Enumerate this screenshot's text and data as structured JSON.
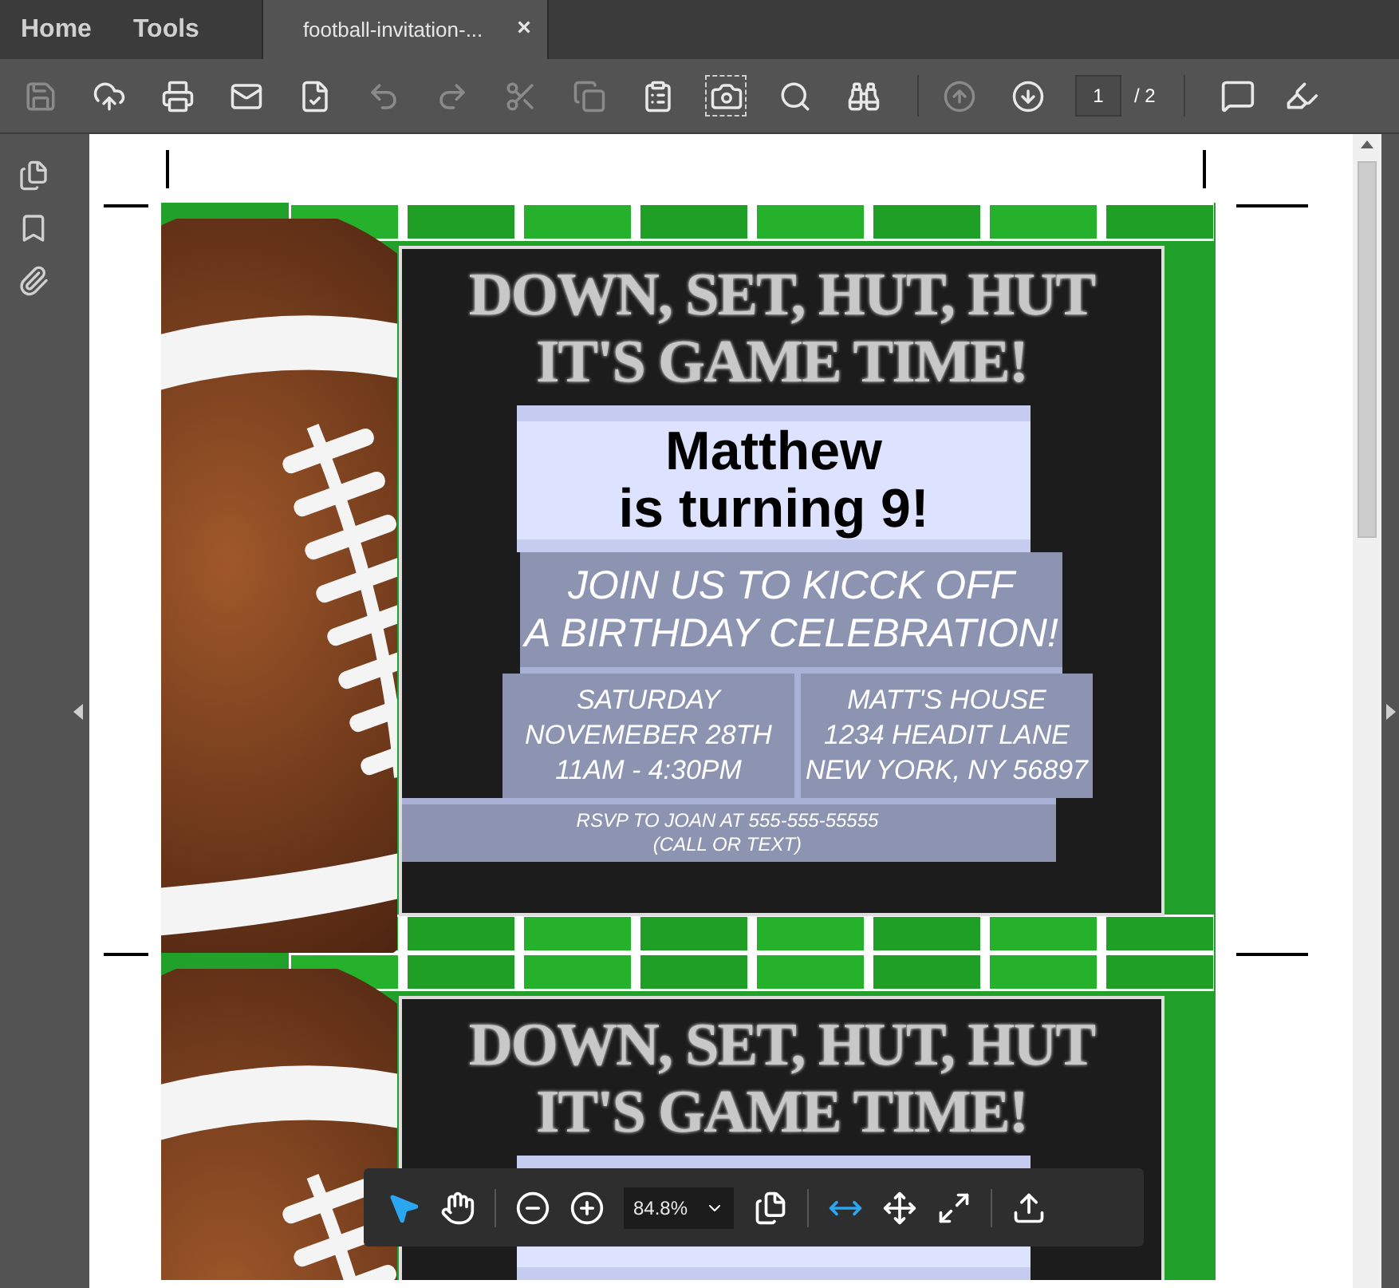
{
  "tabs": [
    {
      "label": "Home",
      "selected": false
    },
    {
      "label": "Tools",
      "selected": false
    }
  ],
  "document_tab": {
    "label": "football-invitation-...",
    "close": "×",
    "selected": true
  },
  "toolbar": [
    {
      "kind": "save",
      "disabled": true
    },
    {
      "kind": "upload",
      "disabled": false
    },
    {
      "kind": "print",
      "disabled": false
    },
    {
      "kind": "mail",
      "disabled": false
    },
    {
      "kind": "spell",
      "disabled": false
    },
    {
      "kind": "undo",
      "disabled": true
    },
    {
      "kind": "redo",
      "disabled": true
    },
    {
      "kind": "cut",
      "disabled": true
    },
    {
      "kind": "copy",
      "disabled": true
    },
    {
      "kind": "paste",
      "disabled": false
    },
    {
      "kind": "snapshot",
      "disabled": false
    },
    {
      "kind": "search",
      "disabled": false
    },
    {
      "kind": "find",
      "disabled": false
    },
    {
      "kind": "prev",
      "disabled": true
    },
    {
      "kind": "next",
      "disabled": false
    }
  ],
  "page_field": {
    "value": "1",
    "total": "/ 2"
  },
  "pages": [
    {
      "headline": [
        "DOWN, SET, HUT, HUT",
        "IT'S GAME TIME!"
      ],
      "name": "Matthew",
      "age_line": "is turning 9!",
      "invite": [
        "JOIN US TO KICCK OFF",
        "A BIRTHDAY CELEBRATION!"
      ],
      "when": [
        "SATURDAY",
        "NOVEMEBER 28TH",
        "11AM - 4:30PM"
      ],
      "where": [
        "MATT'S HOUSE",
        "1234 HEADIT LANE",
        "NEW YORK, NY 56897"
      ],
      "rsvp": [
        "RSVP TO JOAN AT 555-555-55555",
        "(CALL OR TEXT)"
      ]
    },
    {
      "headline": [
        "DOWN, SET, HUT, HUT",
        "IT'S GAME TIME!"
      ]
    }
  ],
  "float_tools": [
    {
      "kind": "select",
      "selected": true
    },
    {
      "kind": "hand",
      "selected": false
    },
    {
      "kind": "zoom_out",
      "selected": false
    },
    {
      "kind": "zoom_in",
      "selected": false
    },
    {
      "kind": "zoom_field",
      "value": "84.8%",
      "selected": false
    },
    {
      "kind": "pages",
      "selected": false
    },
    {
      "kind": "fit_width",
      "selected": true
    },
    {
      "kind": "fit_page",
      "selected": false
    },
    {
      "kind": "full_screen",
      "selected": false
    },
    {
      "kind": "share",
      "selected": false
    }
  ]
}
